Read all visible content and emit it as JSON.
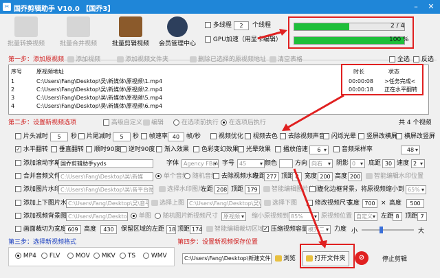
{
  "window": {
    "title": "国乔剪辑助手 V10.0  【国乔3】"
  },
  "toolbar": {
    "items": [
      {
        "label": "批量转换视频"
      },
      {
        "label": "批量合并视频"
      },
      {
        "label": "批量剪辑视频"
      },
      {
        "label": "会员管理中心"
      }
    ],
    "multithread_label": "多线程",
    "threads_value": "2",
    "threads_unit": "个线程",
    "gpu_label": "GPU加速（用显卡编辑）"
  },
  "progress": {
    "bar1_text": "2 / 4",
    "bar1_fraction": 0.5,
    "bar2_text": "100 %",
    "bar2_fraction": 1.0
  },
  "step1": {
    "title": "第一步：添加原视频",
    "add_video": "添加视频",
    "add_folder": "添加视频文件夹",
    "delete_selected": "删除已选择的原视频地址",
    "clear_table": "清空表格",
    "select_all": "全选",
    "invert": "反选"
  },
  "table": {
    "headers": {
      "index": "序号",
      "path": "原视频地址",
      "duration": "时长",
      "status": "状态"
    },
    "rows": [
      {
        "index": "1",
        "path": "C:\\Users\\Fang\\Desktop\\吴\\新媒体\\原视频\\1.mp4",
        "duration": "00:00:08",
        "status": ">任务完成<"
      },
      {
        "index": "2",
        "path": "C:\\Users\\Fang\\Desktop\\吴\\新媒体\\原视频\\2.mp4",
        "duration": "00:00:18",
        "status": "正在水平翻转"
      },
      {
        "index": "3",
        "path": "C:\\Users\\Fang\\Desktop\\吴\\新媒体\\原视频\\5.mp4",
        "duration": "",
        "status": ""
      },
      {
        "index": "4",
        "path": "C:\\Users\\Fang\\Desktop\\吴\\新媒体\\原视频\\6.mp4",
        "duration": "",
        "status": ""
      }
    ]
  },
  "step2": {
    "title": "第二步：设置新视频选项",
    "advanced": "高级自定义",
    "edit": "编辑",
    "before": "在选项前执行",
    "after": "在选项后执行",
    "count": "共 4 个视频"
  },
  "opts": {
    "r1": {
      "head_cut": "片头减时",
      "head_val": "5",
      "head_unit": "秒",
      "tail_cut": "片尾减时",
      "tail_val": "5",
      "tail_unit": "秒",
      "fps": "帧速率",
      "fps_val": "40",
      "fps_unit": "帧/秒",
      "video_opt": "视频优化",
      "remove_color": "视频去色",
      "remove_audio": "去除视频声音",
      "flash": "闪烁光晕",
      "portrait": "竖屏改横屏",
      "landscape": "横屏改竖屏"
    },
    "r2": {
      "hflip": "水平翻转",
      "vflip": "垂直翻转",
      "cw90": "顺时90度",
      "ccw90": "逆时90度",
      "fade_in": "渐入效果",
      "color_change": "色彩变幻效果",
      "light": "光晕效果",
      "speed": "播放倍速",
      "speed_val": "6",
      "samplerate": "音频采样率",
      "samplerate_val": "48"
    },
    "r3": {
      "scroll_sub": "添加滚动字幕",
      "sub_text": "国乔剪辑助手yyds",
      "font": "字体",
      "font_val": "Agency FB(AI",
      "size": "字号",
      "size_val": "45",
      "color": "颜色",
      "direction": "方向",
      "direction_val": "向右",
      "shadow": "阴影",
      "shadow_val": "0",
      "bottom": "底距",
      "bottom_val": "30",
      "speed": "速度",
      "speed_val": "2"
    },
    "r4": {
      "merge_audio": "合并音频文件",
      "audio_path": "C:\\Users\\Fang\\Desktop\\吴\\新媒",
      "single": "单个音频",
      "random": "随机音频",
      "watermark": "去除视频水印",
      "left": "左距",
      "left_val": "277",
      "top": "顶距",
      "top_val": "8",
      "width": "宽度",
      "width_val": "200",
      "height": "高度",
      "height_val": "200",
      "smart_wm": "智能编辑水印位置"
    },
    "r5": {
      "add_pic_wm": "添加图片水印",
      "pic_path": "C:\\Users\\Fang\\Desktop\\吴\\音平台图片\\",
      "select_wm": "选择水印图片",
      "left": "左距",
      "left_val": "208",
      "top": "顶距",
      "top_val": "179",
      "smart_pic": "智能编辑图片位置",
      "blur_bg": "虚化边框背景，将原视频缩小到",
      "blur_val": "65%"
    },
    "r6": {
      "add_tb_pic": "添加上下图片水印",
      "tb_path": "C:\\Users\\Fang\\Desktop\\吴\\音平台\\",
      "select_top": "选择上图",
      "tb_path2": "C:\\Users\\Fang\\Desktop\\吴\\音",
      "select_bottom": "选择下图",
      "resize": "修改视频尺寸",
      "w_label": "宽度",
      "w_val": "700",
      "x": "×",
      "h_label": "高度",
      "h_val": "500"
    },
    "r7": {
      "add_bg_pic": "添加视频背景图片",
      "bg_path": "C:\\Users\\Fang\\Desktop\\吴\\新",
      "single": "单图",
      "random": "随机图片",
      "new_size": "新视频尺寸",
      "new_size_val": "原视频",
      "shrink": "缩小原视频到",
      "shrink_val": "85%",
      "pos": "原视频位置",
      "pos_val": "自定义",
      "left": "左距",
      "left_val": "8",
      "top": "顶距",
      "top_val": "7"
    },
    "r8": {
      "crop": "画面裁切为宽度",
      "crop_w": "609",
      "crop_h_label": "高度",
      "crop_h": "430",
      "keep_left": "保留区域的左距",
      "keep_left_val": "18",
      "keep_top": "顶距",
      "keep_top_val": "174",
      "smart_crop": "智能编辑裁切区域",
      "compress": "压缩视频容量",
      "compress_val": "模式二",
      "strength": "力度",
      "small": "小",
      "big": "大"
    }
  },
  "step3": {
    "title": "第三步：选择新视频格式",
    "formats": [
      "MP4",
      "FLV",
      "MOV",
      "MKV",
      "TS",
      "WMV"
    ],
    "selected": "MP4"
  },
  "step4": {
    "title": "第四步：设置新视频保存位置",
    "save_path": "C:\\Users\\Fang\\Desktop\\新建文件夹",
    "browse": "浏览",
    "open_folder": "打开文件夹",
    "stop": "停止剪辑"
  },
  "colors": {
    "accent": "#1f86d8",
    "progress": "#1dbf3a",
    "highlight": "#e02020",
    "step": "#d02020"
  }
}
